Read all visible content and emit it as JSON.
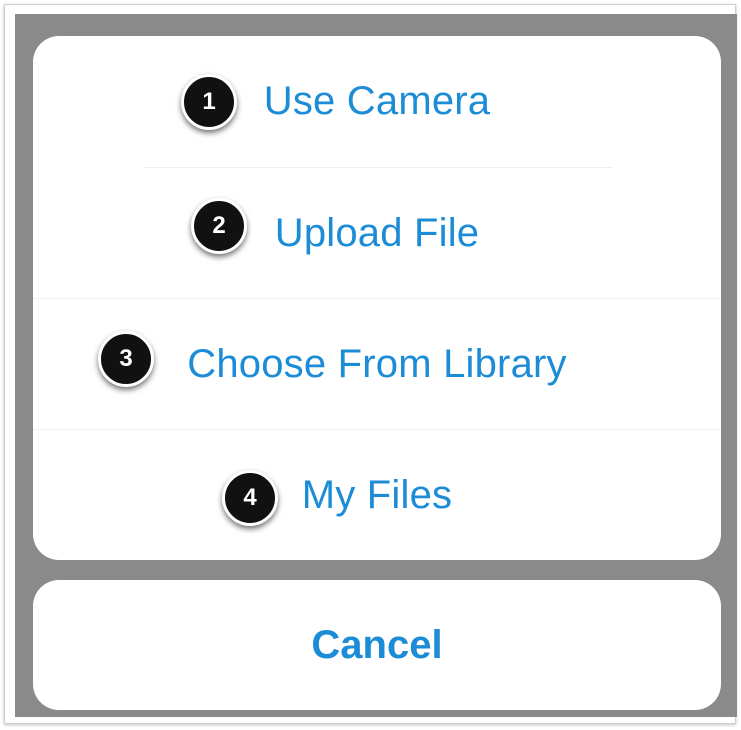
{
  "action_sheet": {
    "options": [
      {
        "number": "1",
        "label": "Use Camera"
      },
      {
        "number": "2",
        "label": "Upload File"
      },
      {
        "number": "3",
        "label": "Choose From Library"
      },
      {
        "number": "4",
        "label": "My Files"
      }
    ],
    "cancel_label": "Cancel"
  },
  "colors": {
    "accent": "#1c8cd6",
    "overlay": "#8a8a8a",
    "badge": "#111111"
  }
}
